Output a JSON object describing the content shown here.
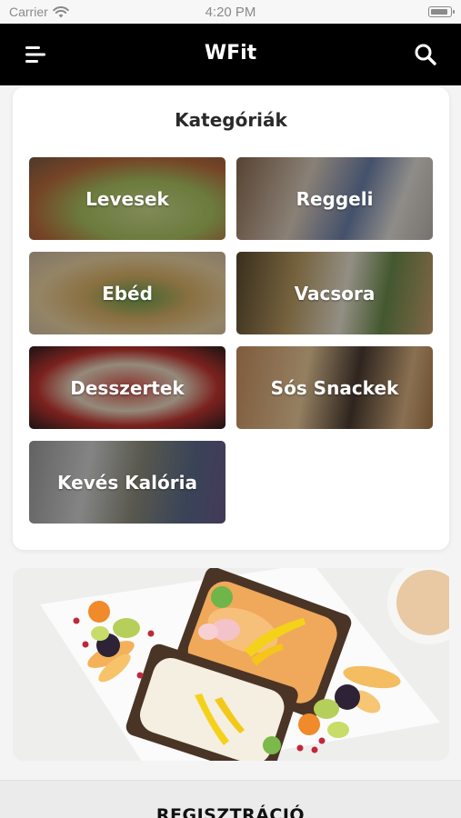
{
  "status": {
    "carrier": "Carrier",
    "time": "4:20 PM"
  },
  "nav": {
    "title": "WFit",
    "menu_icon": "menu-icon",
    "search_icon": "search-icon"
  },
  "categories": {
    "title": "Kategóriák",
    "items": [
      {
        "label": "Levesek"
      },
      {
        "label": "Reggeli"
      },
      {
        "label": "Ebéd"
      },
      {
        "label": "Vacsora"
      },
      {
        "label": "Desszertek"
      },
      {
        "label": "Sós Snackek"
      },
      {
        "label": "Kevés Kalória"
      }
    ]
  },
  "footer": {
    "register_label": "REGISZTRÁCIÓ"
  },
  "colors": {
    "nav_bg": "#000000",
    "nav_text": "#ffffff",
    "page_bg": "#f4f4f4",
    "card_bg": "#ffffff"
  }
}
